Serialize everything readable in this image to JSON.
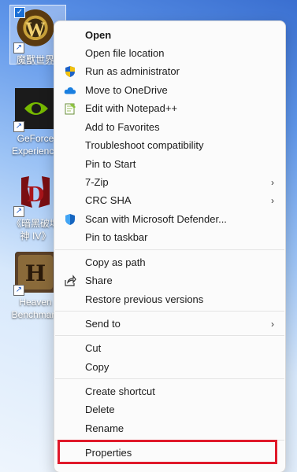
{
  "desktop": {
    "icons": [
      {
        "label": "魔獸世界",
        "selected": true,
        "icon": "world-of-warcraft-icon"
      },
      {
        "label": "GeForce Experience",
        "icon": "nvidia-icon"
      },
      {
        "label": "《暗黑破壞神 IV》",
        "icon": "diablo-icon"
      },
      {
        "label": "Heaven Benchmark",
        "icon": "heaven-icon"
      }
    ]
  },
  "menu": {
    "items": [
      {
        "label": "Open",
        "bold": true
      },
      {
        "label": "Open file location"
      },
      {
        "label": "Run as administrator",
        "icon": "shield-icon"
      },
      {
        "label": "Move to OneDrive",
        "icon": "onedrive-cloud-icon"
      },
      {
        "label": "Edit with Notepad++",
        "icon": "notepad-plus-plus-icon"
      },
      {
        "label": "Add to Favorites"
      },
      {
        "label": "Troubleshoot compatibility"
      },
      {
        "label": "Pin to Start"
      },
      {
        "label": "7-Zip",
        "submenu": true
      },
      {
        "label": "CRC SHA",
        "submenu": true
      },
      {
        "label": "Scan with Microsoft Defender...",
        "icon": "defender-shield-icon"
      },
      {
        "label": "Pin to taskbar"
      },
      {
        "label": "Copy as path"
      },
      {
        "label": "Share",
        "icon": "share-icon"
      },
      {
        "label": "Restore previous versions"
      },
      {
        "label": "Send to",
        "submenu": true
      },
      {
        "label": "Cut"
      },
      {
        "label": "Copy"
      },
      {
        "label": "Create shortcut"
      },
      {
        "label": "Delete"
      },
      {
        "label": "Rename"
      },
      {
        "label": "Properties",
        "highlighted": true
      }
    ],
    "submenu_glyph": "›",
    "highlight_color": "#e0192a"
  }
}
